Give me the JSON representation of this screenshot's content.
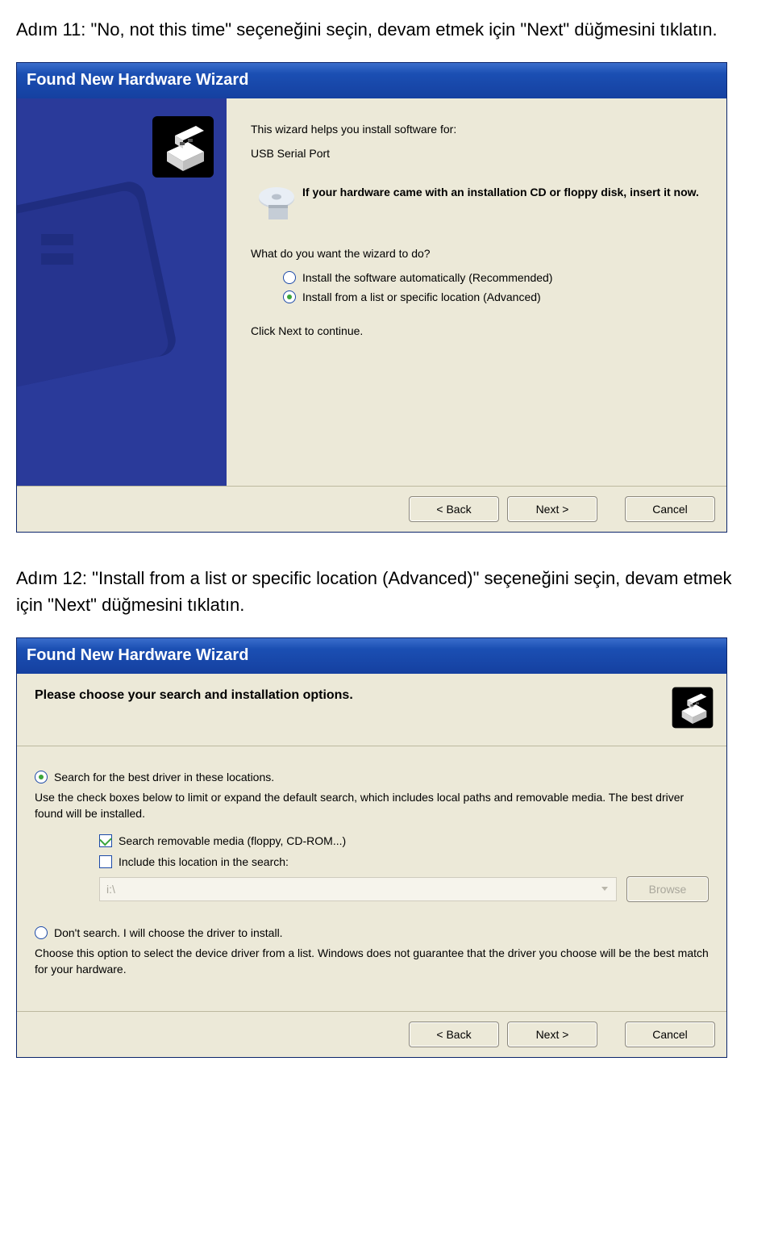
{
  "instructions": {
    "step11": "Adım 11: \"No, not this time\" seçeneğini seçin, devam etmek için \"Next\" düğmesini tıklatın.",
    "step12": "Adım 12: \"Install from a list or specific location (Advanced)\" seçeneğini seçin, devam etmek için \"Next\" düğmesini tıklatın."
  },
  "dialog1": {
    "title": "Found New Hardware Wizard",
    "intro": "This wizard helps you install software for:",
    "device": "USB Serial Port",
    "cd_notice": "If your hardware came with an installation CD or floppy disk, insert it now.",
    "question": "What do you want the wizard to do?",
    "options": {
      "auto": "Install the software automatically (Recommended)",
      "list": "Install from a list or specific location (Advanced)"
    },
    "click_next": "Click Next to continue.",
    "buttons": {
      "back": "< Back",
      "next": "Next >",
      "cancel": "Cancel"
    }
  },
  "dialog2": {
    "title": "Found New Hardware Wizard",
    "heading": "Please choose your search and installation options.",
    "radio_search": "Search for the best driver in these locations.",
    "search_desc": "Use the check boxes below to limit or expand the default search, which includes local paths and removable media. The best driver found will be installed.",
    "check_removable": "Search removable media (floppy, CD-ROM...)",
    "check_include": "Include this location in the search:",
    "path_value": "i:\\",
    "browse": "Browse",
    "radio_dont": "Don't search. I will choose the driver to install.",
    "dont_desc": "Choose this option to select the device driver from a list.  Windows does not guarantee that the driver you choose will be the best match for your hardware.",
    "buttons": {
      "back": "< Back",
      "next": "Next >",
      "cancel": "Cancel"
    }
  }
}
